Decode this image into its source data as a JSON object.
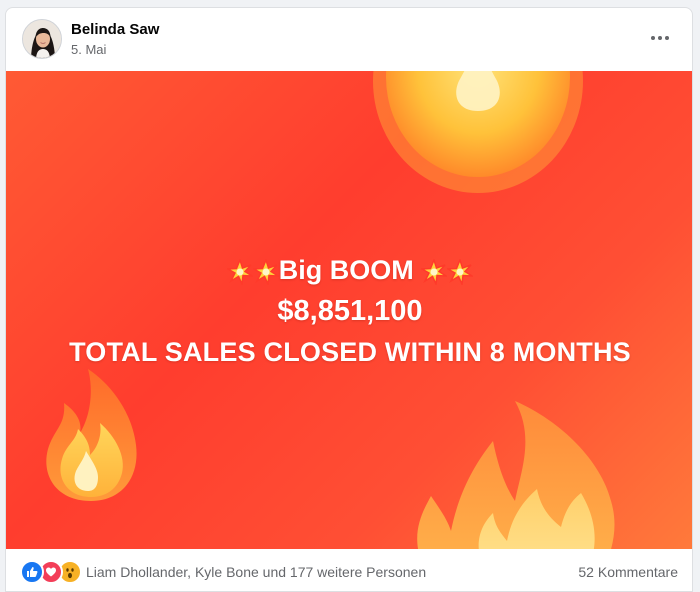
{
  "post": {
    "author": "Belinda Saw",
    "date": "5. Mai",
    "image": {
      "line1": "Big BOOM",
      "line2": "$8,851,100",
      "line3": "TOTAL SALES CLOSED WITHIN 8 MONTHS"
    },
    "reactions": [
      "like-icon",
      "love-icon",
      "wow-icon"
    ],
    "reactors_text": "Liam Dhollander, Kyle Bone und 177 weitere Personen",
    "comments_text": "52 Kommentare"
  },
  "colors": {
    "background_gradient": [
      "#ff5a34",
      "#ff3d2e",
      "#ff7a3b"
    ],
    "text_secondary": "#65676b",
    "like_blue": "#1877f2",
    "love_red": "#f33e58",
    "wow_yellow": "#f7b125"
  }
}
